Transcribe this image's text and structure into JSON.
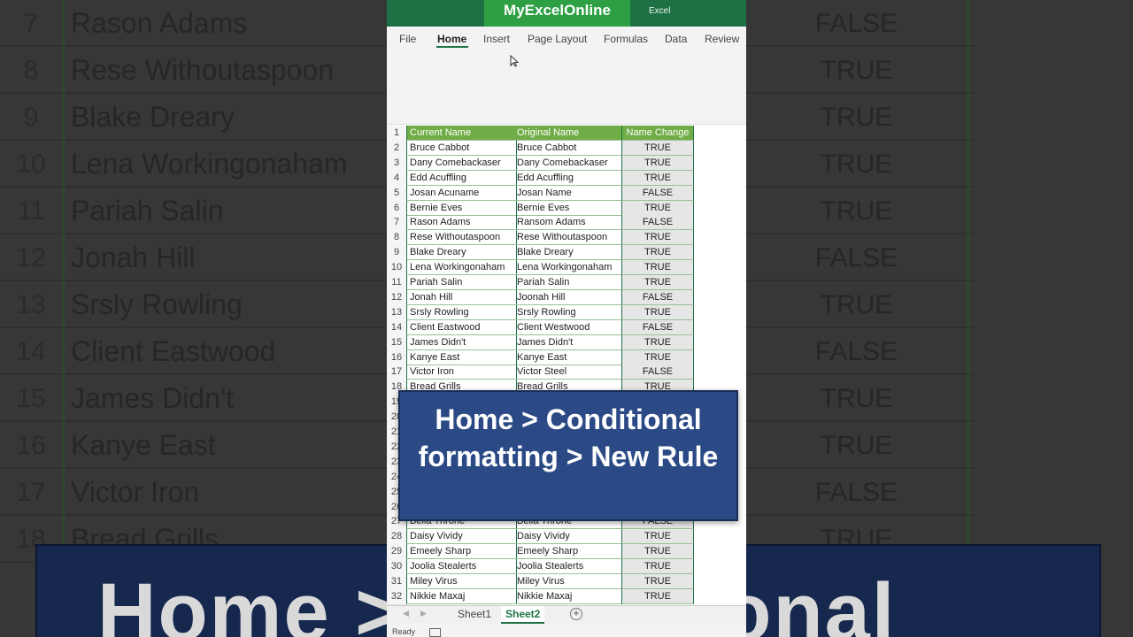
{
  "header": {
    "brand": "MyExcelOnline",
    "app_label": "Excel"
  },
  "ribbon": {
    "tabs": [
      "File",
      "Home",
      "Insert",
      "Page Layout",
      "Formulas",
      "Data",
      "Review"
    ],
    "active_tab": "Home"
  },
  "sheet": {
    "columns": [
      "Current Name",
      "Original Name",
      "Name Change"
    ],
    "rows": [
      {
        "n": "2",
        "current": "Bruce Cabbot",
        "original": "Bruce Cabbot",
        "change": "TRUE"
      },
      {
        "n": "3",
        "current": "Dany Comebackaser",
        "original": "Dany Comebackaser",
        "change": "TRUE"
      },
      {
        "n": "4",
        "current": "Edd Acuffling",
        "original": "Edd Acuffling",
        "change": "TRUE"
      },
      {
        "n": "5",
        "current": "Josan Acuname",
        "original": "Josan Name",
        "change": "FALSE"
      },
      {
        "n": "6",
        "current": "Bernie Eves",
        "original": "Bernie Eves",
        "change": "TRUE"
      },
      {
        "n": "7",
        "current": "Rason Adams",
        "original": "Ransom Adams",
        "change": "FALSE"
      },
      {
        "n": "8",
        "current": "Rese Withoutaspoon",
        "original": "Rese Withoutaspoon",
        "change": "TRUE"
      },
      {
        "n": "9",
        "current": "Blake Dreary",
        "original": "Blake Dreary",
        "change": "TRUE"
      },
      {
        "n": "10",
        "current": "Lena Workingonaham",
        "original": "Lena Workingonaham",
        "change": "TRUE"
      },
      {
        "n": "11",
        "current": "Pariah Salin",
        "original": "Pariah Salin",
        "change": "TRUE"
      },
      {
        "n": "12",
        "current": "Jonah Hill",
        "original": "Joonah Hill",
        "change": "FALSE"
      },
      {
        "n": "13",
        "current": "Srsly Rowling",
        "original": "Srsly Rowling",
        "change": "TRUE"
      },
      {
        "n": "14",
        "current": "Client Eastwood",
        "original": "Client Westwood",
        "change": "FALSE"
      },
      {
        "n": "15",
        "current": "James Didn't",
        "original": "James Didn't",
        "change": "TRUE"
      },
      {
        "n": "16",
        "current": "Kanye East",
        "original": "Kanye East",
        "change": "TRUE"
      },
      {
        "n": "17",
        "current": "Victor Iron",
        "original": "Victor Steel",
        "change": "FALSE"
      },
      {
        "n": "18",
        "current": "Bread Grills",
        "original": "Bread Grills",
        "change": "TRUE"
      }
    ],
    "rows_bottom": [
      {
        "n": "27",
        "current": "Bella Throne",
        "original": "Bella Throne",
        "change": "FALSE"
      },
      {
        "n": "28",
        "current": "Daisy Vividy",
        "original": "Daisy Vividy",
        "change": "TRUE"
      },
      {
        "n": "29",
        "current": "Emeely Sharp",
        "original": "Emeely Sharp",
        "change": "TRUE"
      },
      {
        "n": "30",
        "current": "Joolia Stealerts",
        "original": "Joolia Stealerts",
        "change": "TRUE"
      },
      {
        "n": "31",
        "current": "Miley Virus",
        "original": "Miley Virus",
        "change": "TRUE"
      },
      {
        "n": "32",
        "current": "Nikkie Maxaj",
        "original": "Nikkie Maxaj",
        "change": "TRUE"
      }
    ],
    "hidden_row_numbers": [
      "19",
      "20",
      "21",
      "22",
      "23",
      "24",
      "25",
      "26"
    ]
  },
  "callout": {
    "text": "Home > Conditional formatting > New Rule"
  },
  "sheet_tabs": [
    "Sheet1",
    "Sheet2"
  ],
  "active_sheet": "Sheet2",
  "status": {
    "text": "Ready"
  },
  "background": {
    "rows": [
      {
        "n": "7",
        "name": "Rason Adams",
        "val": "FALSE"
      },
      {
        "n": "8",
        "name": "Rese Withoutaspoon",
        "val": "TRUE"
      },
      {
        "n": "9",
        "name": "Blake Dreary",
        "val": "TRUE"
      },
      {
        "n": "10",
        "name": "Lena Workingonaham",
        "val": "TRUE"
      },
      {
        "n": "11",
        "name": "Pariah Salin",
        "val": "TRUE"
      },
      {
        "n": "12",
        "name": "Jonah Hill",
        "val": "FALSE"
      },
      {
        "n": "13",
        "name": "Srsly Rowling",
        "val": "TRUE"
      },
      {
        "n": "14",
        "name": "Client Eastwood",
        "val": "FALSE"
      },
      {
        "n": "15",
        "name": "James Didn't",
        "val": "TRUE"
      },
      {
        "n": "16",
        "name": "Kanye East",
        "val": "TRUE"
      },
      {
        "n": "17",
        "name": "Victor Iron",
        "val": "FALSE"
      },
      {
        "n": "18",
        "name": "Bread Grills",
        "val": "TRUE"
      }
    ],
    "banner_text": "Home > Conditional"
  }
}
